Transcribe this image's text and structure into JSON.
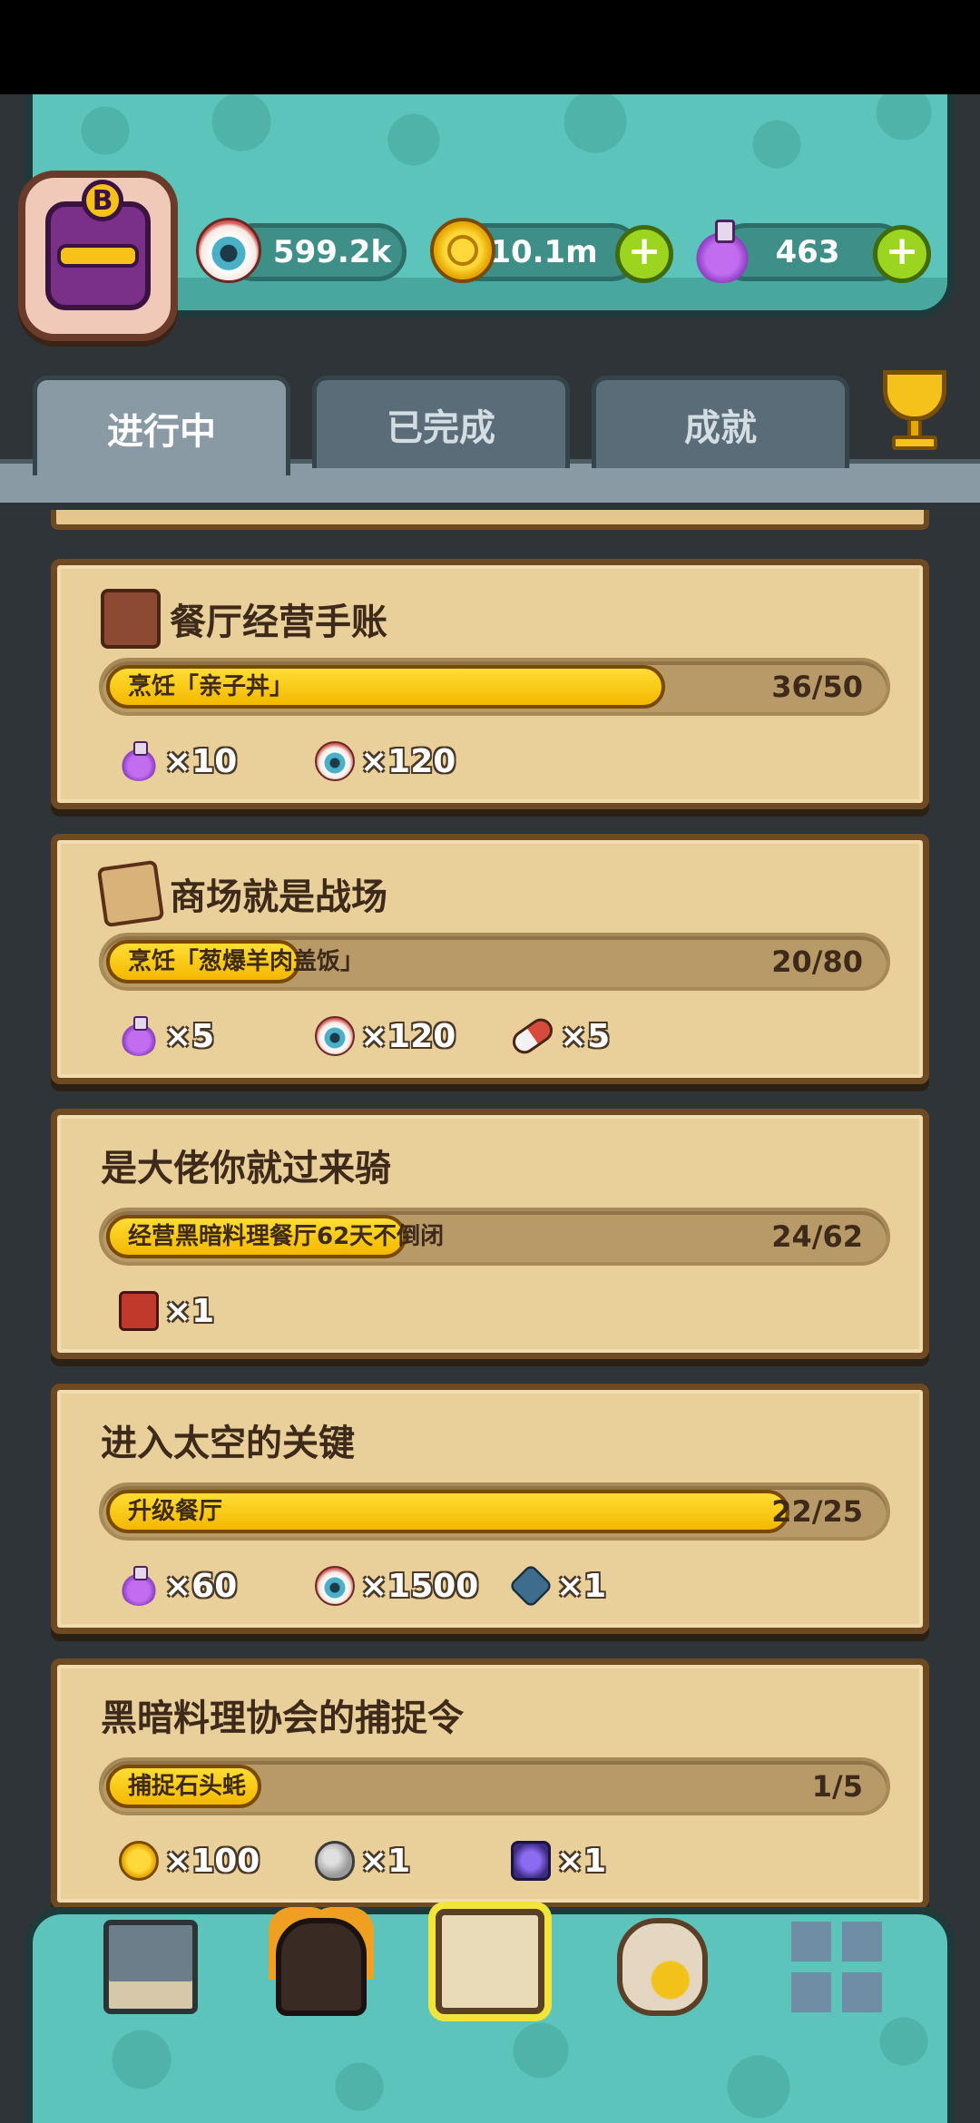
{
  "header": {
    "avatar_badge": "B",
    "resources": [
      {
        "icon": "eyeball-icon",
        "value": "599.2k"
      },
      {
        "icon": "gold-coin-icon",
        "value": "10.1m"
      },
      {
        "icon": "purple-potion-icon",
        "value": "463"
      }
    ]
  },
  "tabs": [
    {
      "label": "进行中",
      "active": true
    },
    {
      "label": "已完成",
      "active": false
    },
    {
      "label": "成就",
      "active": false
    }
  ],
  "quests": [
    {
      "title": "餐厅经营手账",
      "icon": "ledger-book-icon",
      "task": "烹饪「亲子丼」",
      "current": 36,
      "target": 50,
      "count": "36/50",
      "rewards": [
        {
          "icon": "purple-potion-icon",
          "text": "×10"
        },
        {
          "icon": "eyeball-icon",
          "text": "×120"
        }
      ]
    },
    {
      "title": "商场就是战场",
      "icon": "battle-map-icon",
      "task": "烹饪「葱爆羊肉盖饭」",
      "current": 20,
      "target": 80,
      "count": "20/80",
      "rewards": [
        {
          "icon": "purple-potion-icon",
          "text": "×5"
        },
        {
          "icon": "eyeball-icon",
          "text": "×120"
        },
        {
          "icon": "capsule-icon",
          "text": "×5"
        }
      ]
    },
    {
      "title": "是大佬你就过来骑",
      "icon": "",
      "task": "经营黑暗料理餐厅62天不倒闭",
      "current": 24,
      "target": 62,
      "count": "24/62",
      "rewards": [
        {
          "icon": "red-chest-icon",
          "text": "×1"
        }
      ]
    },
    {
      "title": "进入太空的关键",
      "icon": "",
      "task": "升级餐厅",
      "current": 22,
      "target": 25,
      "count": "22/25",
      "rewards": [
        {
          "icon": "purple-potion-icon",
          "text": "×60"
        },
        {
          "icon": "eyeball-icon",
          "text": "×1500"
        },
        {
          "icon": "gem-emblem-icon",
          "text": "×1"
        }
      ]
    },
    {
      "title": "黑暗料理协会的捕捉令",
      "icon": "",
      "task": "捕捉石头蚝",
      "current": 1,
      "target": 5,
      "count": "1/5",
      "rewards": [
        {
          "icon": "gold-coin-icon",
          "text": "×100"
        },
        {
          "icon": "stone-egg-icon",
          "text": "×1"
        },
        {
          "icon": "purple-crystal-icon",
          "text": "×1"
        }
      ]
    }
  ],
  "bottom_nav": [
    {
      "icon": "restaurant-icon",
      "active": false
    },
    {
      "icon": "monster-icon",
      "active": false
    },
    {
      "icon": "quest-book-icon",
      "active": true
    },
    {
      "icon": "money-bag-icon",
      "active": false
    },
    {
      "icon": "grid-menu-icon",
      "active": false
    }
  ]
}
